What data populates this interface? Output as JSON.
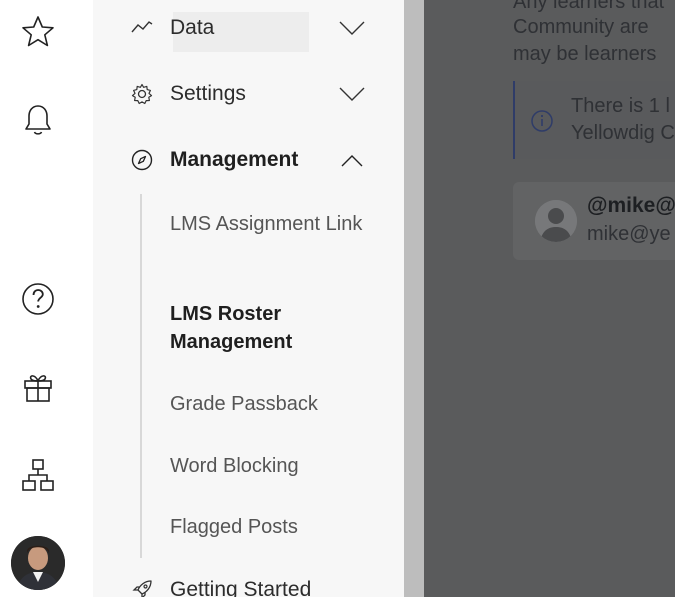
{
  "rail": {
    "items": [
      {
        "icon": "star-icon"
      },
      {
        "icon": "bell-icon"
      },
      {
        "icon": "help-icon"
      },
      {
        "icon": "gift-icon"
      },
      {
        "icon": "org-chart-icon"
      }
    ],
    "avatar": "user-avatar"
  },
  "nav": {
    "data_label": "Data",
    "settings_label": "Settings",
    "management_label": "Management",
    "getting_started_label": "Getting Started",
    "sub_items": [
      "LMS Assignment Link",
      "LMS Roster Management",
      "Grade Passback",
      "Word Blocking",
      "Flagged Posts"
    ],
    "active_sub_item": "LMS Roster Management"
  },
  "main": {
    "line1": "Any learners that",
    "line2": "Community are",
    "line3": "may be learners",
    "info_line1": "There is 1 l",
    "info_line2": "Yellowdig C",
    "user_handle": "@mike@",
    "user_email": "mike@ye"
  },
  "colors": {
    "nav_bg": "#f7f7f7",
    "overlay": "#5a5b5c",
    "accent": "#2f3c68"
  }
}
